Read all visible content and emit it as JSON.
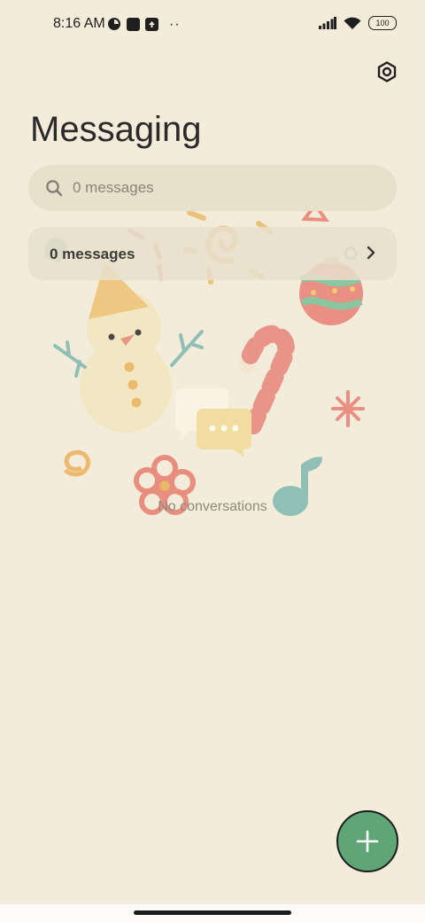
{
  "status_bar": {
    "time": "8:16 AM",
    "battery": "100",
    "icons": [
      "data-saver-icon",
      "notification-square-icon",
      "upload-icon",
      "more-dots-icon",
      "signal-icon",
      "wifi-icon",
      "battery-icon"
    ],
    "more_dots": "··"
  },
  "header": {
    "title": "Messaging",
    "settings_icon": "settings-hexagon-icon"
  },
  "search": {
    "placeholder": "0 messages"
  },
  "messages_row": {
    "label": "0 messages"
  },
  "empty_state": {
    "text": "No conversations"
  },
  "fab": {
    "icon": "plus-icon",
    "color": "#5fa576"
  },
  "colors": {
    "background": "#f4ecda",
    "search_bg": "#e9e0cc"
  }
}
